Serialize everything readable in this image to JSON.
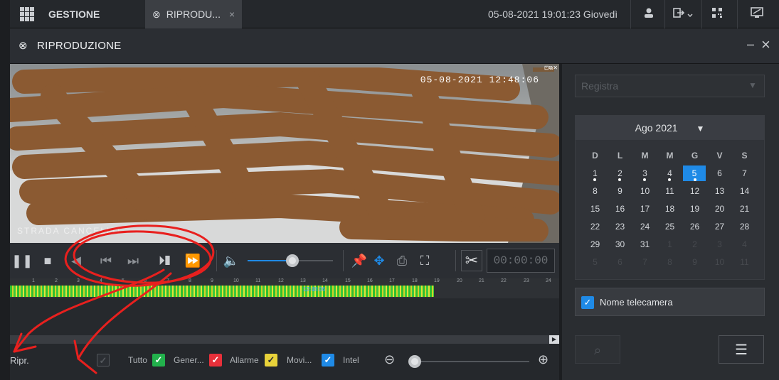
{
  "topbar": {
    "menu_label": "GESTIONE",
    "tab_label": "RIPRODU...",
    "tab_close": "×",
    "datetime": "05-08-2021 19:01:23 Giovedì"
  },
  "window": {
    "title": "RIPRODUZIONE",
    "minimize": "–",
    "close": "×"
  },
  "video": {
    "timestamp": "05-08-2021 12:48:06",
    "camera_label": "STRADA CANCELLO",
    "overlay_controls": "⊡⧉✕"
  },
  "controls": {
    "time_display": "00:00:00"
  },
  "timeline": {
    "ticks": [
      "1",
      "2",
      "3",
      "4",
      "5",
      "6",
      "7",
      "8",
      "9",
      "10",
      "11",
      "12",
      "13",
      "14",
      "15",
      "16",
      "17",
      "18",
      "19",
      "20",
      "21",
      "22",
      "23",
      "24"
    ],
    "current_time": "12:48:06",
    "recorded_until_hour": 19
  },
  "bottom": {
    "label": "Ripr.",
    "filters": [
      {
        "label": "Tutto",
        "color": "#2b2e33",
        "checked": true
      },
      {
        "label": "Gener...",
        "color": "#22b14c",
        "checked": true
      },
      {
        "label": "Allarme",
        "color": "#e8303a",
        "checked": true
      },
      {
        "label": "Movi...",
        "color": "#e8d23a",
        "checked": true
      },
      {
        "label": "Intel",
        "color": "#1f8ae6",
        "checked": true
      }
    ]
  },
  "sidebar": {
    "select_placeholder": "Registra",
    "calendar": {
      "month_label": "Ago 2021",
      "weekdays": [
        "D",
        "L",
        "M",
        "M",
        "G",
        "V",
        "S"
      ],
      "selected_day": 5,
      "days_with_recordings": [
        1,
        2,
        3,
        4,
        5
      ],
      "weeks": [
        [
          "1",
          "2",
          "3",
          "4",
          "5",
          "6",
          "7"
        ],
        [
          "8",
          "9",
          "10",
          "11",
          "12",
          "13",
          "14"
        ],
        [
          "15",
          "16",
          "17",
          "18",
          "19",
          "20",
          "21"
        ],
        [
          "22",
          "23",
          "24",
          "25",
          "26",
          "27",
          "28"
        ],
        [
          "29",
          "30",
          "31",
          "1",
          "2",
          "3",
          "4"
        ],
        [
          "5",
          "6",
          "7",
          "8",
          "9",
          "10",
          "11"
        ]
      ]
    },
    "camera_name_label": "Nome telecamera"
  },
  "colors": {
    "accent": "#1f8ae6",
    "annotation": "#e8201e",
    "redaction": "#8b5a32"
  }
}
